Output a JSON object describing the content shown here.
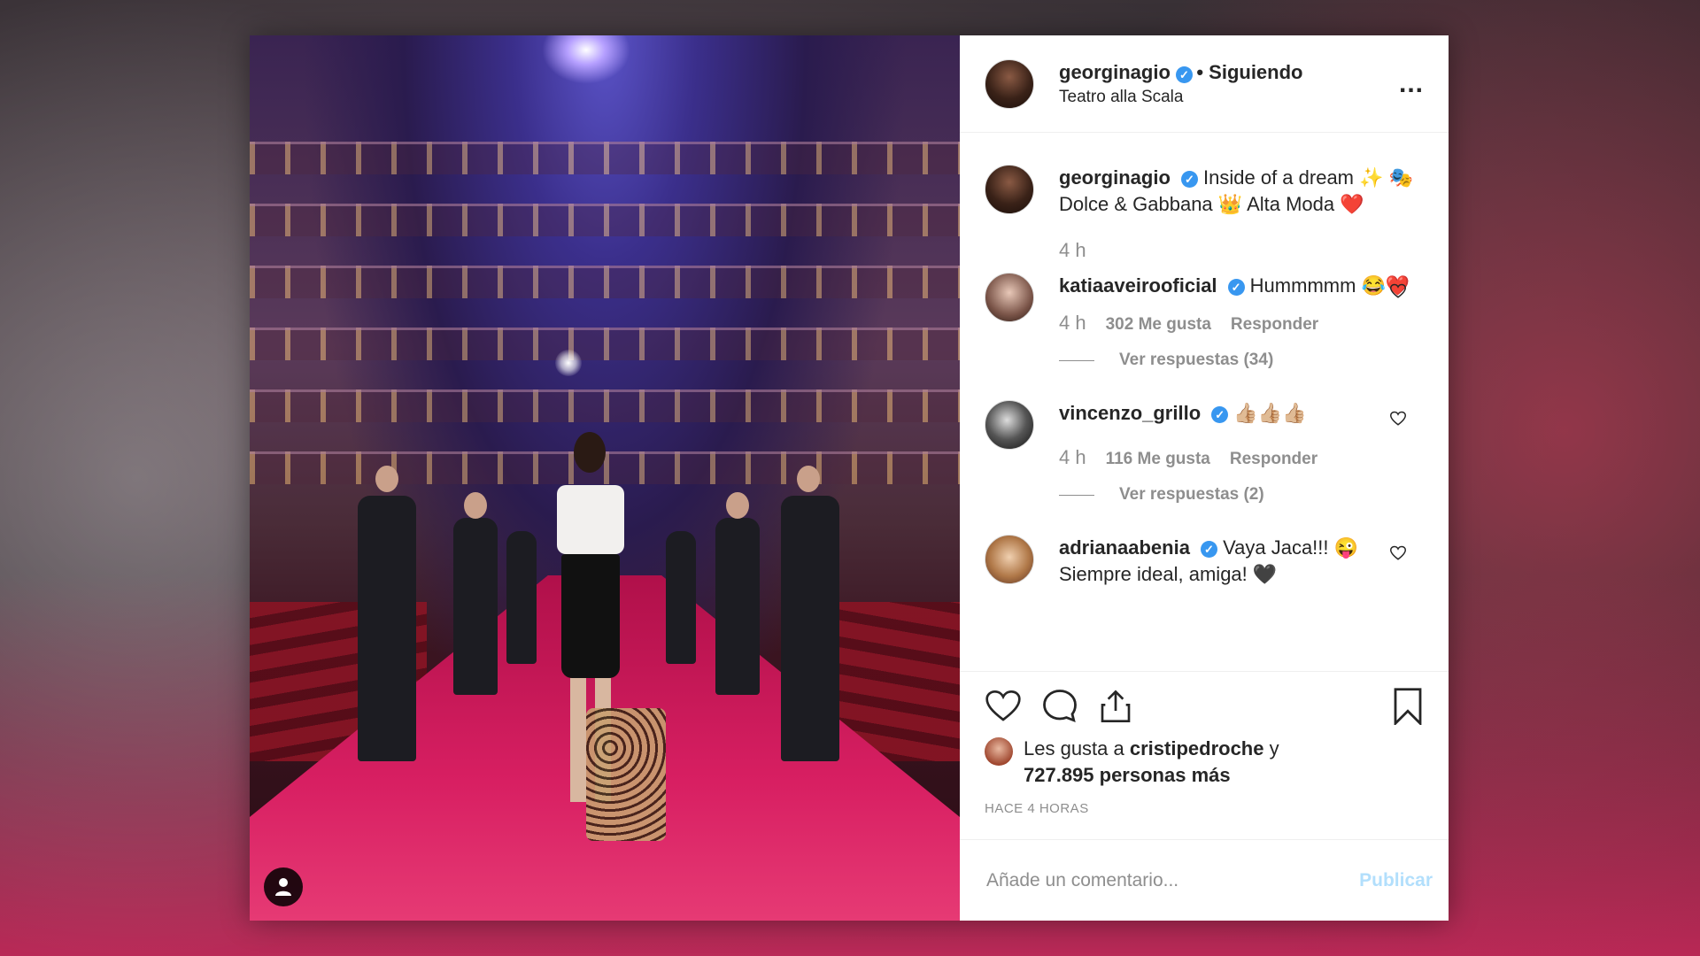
{
  "post": {
    "username": "georginagio",
    "following": "• Siguiendo",
    "location": "Teatro alla Scala",
    "more": "..."
  },
  "caption": {
    "username": "georginagio",
    "text": "Inside of a dream ✨ 🎭 Dolce & Gabbana 👑 Alta Moda ❤️",
    "time": "4 h"
  },
  "comments": [
    {
      "username": "katiaaveirooficial",
      "text": "Hummmmm 😂❤️",
      "time": "4 h",
      "likes": "302 Me gusta",
      "reply": "Responder",
      "view_replies": "Ver respuestas (34)"
    },
    {
      "username": "vincenzo_grillo",
      "text": "👍🏼👍🏼👍🏼",
      "time": "4 h",
      "likes": "116 Me gusta",
      "reply": "Responder",
      "view_replies": "Ver respuestas (2)"
    },
    {
      "username": "adrianaabenia",
      "text": "Vaya Jaca!!! 😜 Siempre ideal, amiga! 🖤"
    }
  ],
  "likes": {
    "prefix": "Les gusta a",
    "user": "cristipedroche",
    "conj": "y",
    "others": "727.895 personas más"
  },
  "timestamp": "HACE 4 HORAS",
  "add_comment": {
    "placeholder": "Añade un comentario...",
    "publish": "Publicar"
  },
  "icons": [
    "heart-icon",
    "comment-icon",
    "share-icon",
    "bookmark-icon",
    "user-tag-icon",
    "verified-icon"
  ],
  "colors": {
    "verified": "#3897f0",
    "publish_disabled": "#b2dffc",
    "text": "#262626",
    "muted": "#8e8e8e"
  }
}
